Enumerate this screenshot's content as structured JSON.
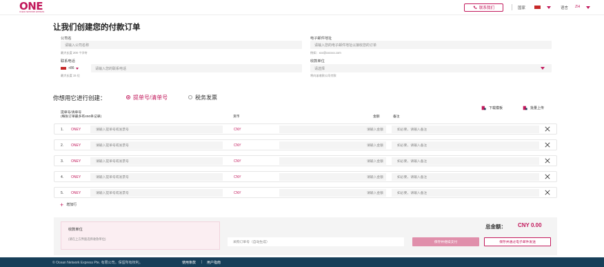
{
  "header": {
    "logo": "ONE",
    "logo_tagline": "OCEAN NETWORK EXPRESS",
    "contact_label": "联系我们",
    "country_label": "国家",
    "language_label": "语言",
    "language_value": "ZH"
  },
  "page_title": "让我们创建您的付款订单",
  "form": {
    "company": {
      "label": "公司名",
      "placeholder": "请输入公司名称",
      "hint": "最大长度 200 个字符"
    },
    "email": {
      "label": "电子邮件地址",
      "placeholder": "请输入您的电子邮件地址以接收您的订单",
      "hint": "例如：xxx@xxxxxx.com"
    },
    "phone": {
      "label": "联系电话",
      "country_code": "+86",
      "placeholder": "请输入您的联系电话",
      "hint": "最大长度 15 位"
    },
    "payee": {
      "label": "收款单位",
      "placeholder": "请选择",
      "hint": "将向该收款公司付款"
    }
  },
  "create_with": {
    "label": "你想用它进行创建：",
    "option_bl": "提单号/清单号",
    "option_invoice": "税务发票"
  },
  "actions": {
    "download_template": "下载模板",
    "bulk_upload": "批量上传"
  },
  "table": {
    "col_bl_line1": "提单号/清单号",
    "col_bl_line2": "(每张订单最多有450条记录)",
    "col_currency": "货币",
    "col_amount": "金额",
    "col_remark": "备注",
    "rows": [
      {
        "num": "1.",
        "prefix": "ONEY",
        "bl_placeholder": "请输入提单号或发票号",
        "currency": "CNY",
        "amount_placeholder": "请输入金额",
        "remark_placeholder": "如必要，请输入备注"
      },
      {
        "num": "2.",
        "prefix": "ONEY",
        "bl_placeholder": "请输入提单号或发票号",
        "currency": "CNY",
        "amount_placeholder": "请输入金额",
        "remark_placeholder": "如必要，请输入备注"
      },
      {
        "num": "3.",
        "prefix": "ONEY",
        "bl_placeholder": "请输入提单号或发票号",
        "currency": "CNY",
        "amount_placeholder": "请输入金额",
        "remark_placeholder": "如必要，请输入备注"
      },
      {
        "num": "4.",
        "prefix": "ONEY",
        "bl_placeholder": "请输入提单号或发票号",
        "currency": "CNY",
        "amount_placeholder": "请输入金额",
        "remark_placeholder": "如必要，请输入备注"
      },
      {
        "num": "5.",
        "prefix": "ONEY",
        "bl_placeholder": "请输入提单号或发票号",
        "currency": "CNY",
        "amount_placeholder": "请输入金额",
        "remark_placeholder": "如必要，请输入备注"
      }
    ],
    "add_row": "增加行"
  },
  "summary": {
    "payee_title": "收款单位",
    "payee_hint": "(请在上方界面选择收款单位)",
    "total_label": "总金额：",
    "total_value": "CNY 0.00",
    "order_ref_placeholder": "采购订单号（自动生成）",
    "save_and_pay": "保存并继续支付",
    "save_and_email": "保存并通过电子邮件发送"
  },
  "footer": {
    "copyright": "© Ocean Network Express Pte. 有限公司。保留所有权利。",
    "link_terms": "使用条款",
    "link_guide": "用户指南"
  },
  "colors": {
    "brand": "#c2185b",
    "footer_bg": "#173f59"
  }
}
